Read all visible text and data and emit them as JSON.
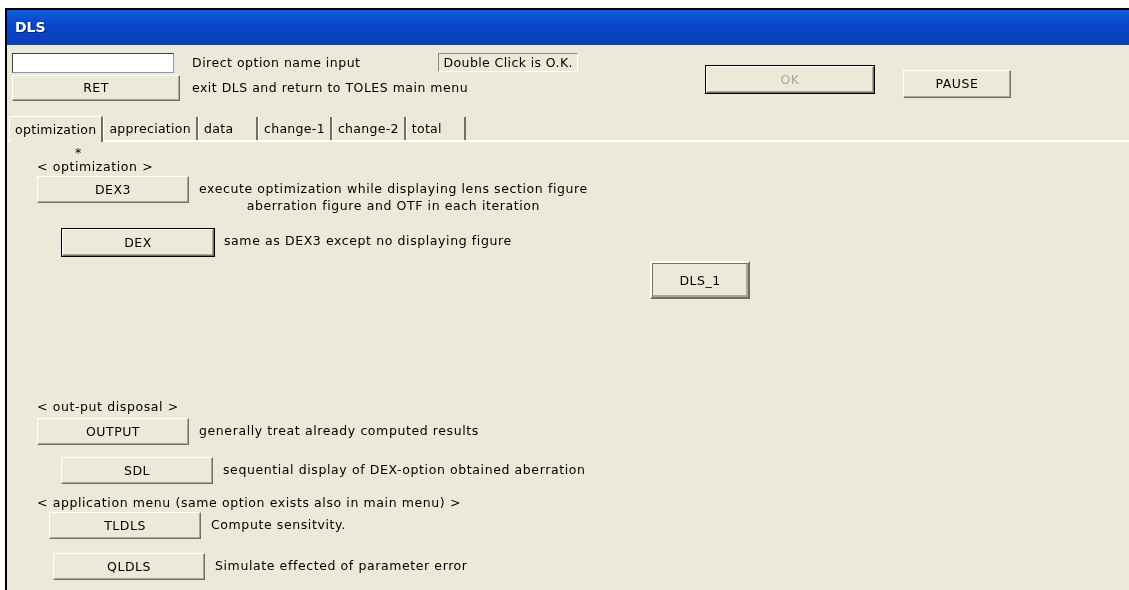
{
  "window": {
    "title": "DLS"
  },
  "header": {
    "input_label": "Direct option name input",
    "hint": "Double Click is O.K.",
    "ret": {
      "label": "RET",
      "description": "exit DLS and return to TOLES main menu"
    },
    "ok": {
      "label": "OK",
      "disabled": true,
      "default": true
    },
    "pause": {
      "label": "PAUSE",
      "disabled": false,
      "default": false
    }
  },
  "tabs": [
    {
      "label": "optimization",
      "selected": true
    },
    {
      "label": "appreciation",
      "selected": false
    },
    {
      "label": "data",
      "selected": false
    },
    {
      "label": "change-1",
      "selected": false
    },
    {
      "label": "change-2",
      "selected": false
    },
    {
      "label": "total",
      "selected": false
    }
  ],
  "sections": [
    {
      "marker": "*",
      "heading": "< optimization >",
      "items": [
        {
          "button": "DEX3",
          "default": false,
          "description": "execute optimization while displaying lens section figure\naberration figure and OTF in each iteration"
        },
        {
          "button": "DEX",
          "default": true,
          "description": "same as DEX3 except no displaying figure"
        }
      ],
      "side_button": {
        "label": "DLS_1"
      }
    },
    {
      "heading": "< out-put disposal >",
      "items": [
        {
          "button": "OUTPUT",
          "default": false,
          "description": "generally treat already computed results"
        },
        {
          "button": "SDL",
          "default": false,
          "description": "sequential display of DEX-option obtained aberration"
        }
      ]
    },
    {
      "heading": "< application menu (same option exists also in main menu) >",
      "items": [
        {
          "button": "TLDLS",
          "default": false,
          "description": "Compute sensitvity."
        },
        {
          "button": "QLDLS",
          "default": false,
          "description": "Simulate effected of parameter error"
        }
      ]
    }
  ]
}
